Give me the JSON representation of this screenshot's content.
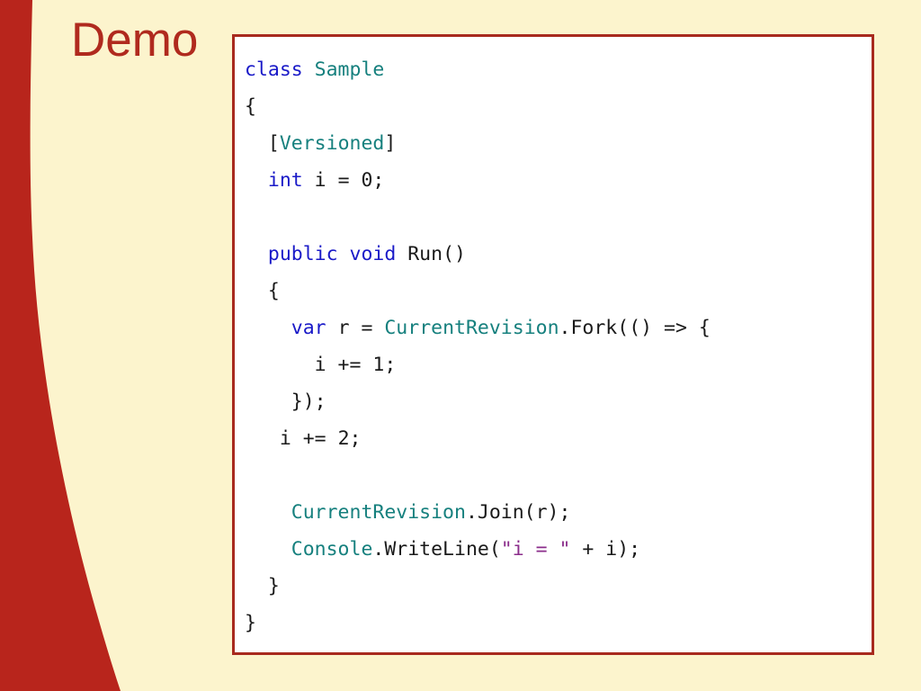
{
  "slide": {
    "title": "Demo",
    "title_color": "#B02A1E",
    "background_color": "#FCF4CD",
    "accent_color": "#B8251C"
  },
  "code_panel": {
    "border_color": "#A82A1E",
    "background_color": "#FFFFFF",
    "language": "csharp",
    "syntax_colors": {
      "keyword": "#1A1AC8",
      "type": "#16807E",
      "plain": "#1A1A1A",
      "string": "#8B2D8B"
    },
    "raw_text": "class Sample\n{\n  [Versioned]\n  int i = 0;\n\n  public void Run()\n  {\n    var r = CurrentRevision.Fork(() => {\n      i += 1;\n    });\n   i += 2;\n\n    CurrentRevision.Join(r);\n    Console.WriteLine(\"i = \" + i);\n  }\n}",
    "lines": [
      {
        "indent": "",
        "tokens": [
          {
            "t": "class ",
            "c": "kw"
          },
          {
            "t": "Sample",
            "c": "type"
          }
        ]
      },
      {
        "indent": "",
        "tokens": [
          {
            "t": "{",
            "c": "plain"
          }
        ]
      },
      {
        "indent": "  ",
        "tokens": [
          {
            "t": "[",
            "c": "plain"
          },
          {
            "t": "Versioned",
            "c": "type"
          },
          {
            "t": "]",
            "c": "plain"
          }
        ]
      },
      {
        "indent": "  ",
        "tokens": [
          {
            "t": "int",
            "c": "kw"
          },
          {
            "t": " i = 0;",
            "c": "plain"
          }
        ]
      },
      {
        "indent": "",
        "tokens": []
      },
      {
        "indent": "  ",
        "tokens": [
          {
            "t": "public void ",
            "c": "kw"
          },
          {
            "t": "Run()",
            "c": "plain"
          }
        ]
      },
      {
        "indent": "  ",
        "tokens": [
          {
            "t": "{",
            "c": "plain"
          }
        ]
      },
      {
        "indent": "    ",
        "tokens": [
          {
            "t": "var",
            "c": "kw"
          },
          {
            "t": " r = ",
            "c": "plain"
          },
          {
            "t": "CurrentRevision",
            "c": "type"
          },
          {
            "t": ".Fork(() => {",
            "c": "plain"
          }
        ]
      },
      {
        "indent": "      ",
        "tokens": [
          {
            "t": "i += 1;",
            "c": "plain"
          }
        ]
      },
      {
        "indent": "    ",
        "tokens": [
          {
            "t": "});",
            "c": "plain"
          }
        ]
      },
      {
        "indent": "   ",
        "tokens": [
          {
            "t": "i += 2;",
            "c": "plain"
          }
        ]
      },
      {
        "indent": "",
        "tokens": []
      },
      {
        "indent": "    ",
        "tokens": [
          {
            "t": "CurrentRevision",
            "c": "type"
          },
          {
            "t": ".Join(r);",
            "c": "plain"
          }
        ]
      },
      {
        "indent": "    ",
        "tokens": [
          {
            "t": "Console",
            "c": "type"
          },
          {
            "t": ".WriteLine(",
            "c": "plain"
          },
          {
            "t": "\"i = \"",
            "c": "string"
          },
          {
            "t": " + i);",
            "c": "plain"
          }
        ]
      },
      {
        "indent": "  ",
        "tokens": [
          {
            "t": "}",
            "c": "plain"
          }
        ]
      },
      {
        "indent": "",
        "tokens": [
          {
            "t": "}",
            "c": "plain"
          }
        ]
      }
    ]
  }
}
